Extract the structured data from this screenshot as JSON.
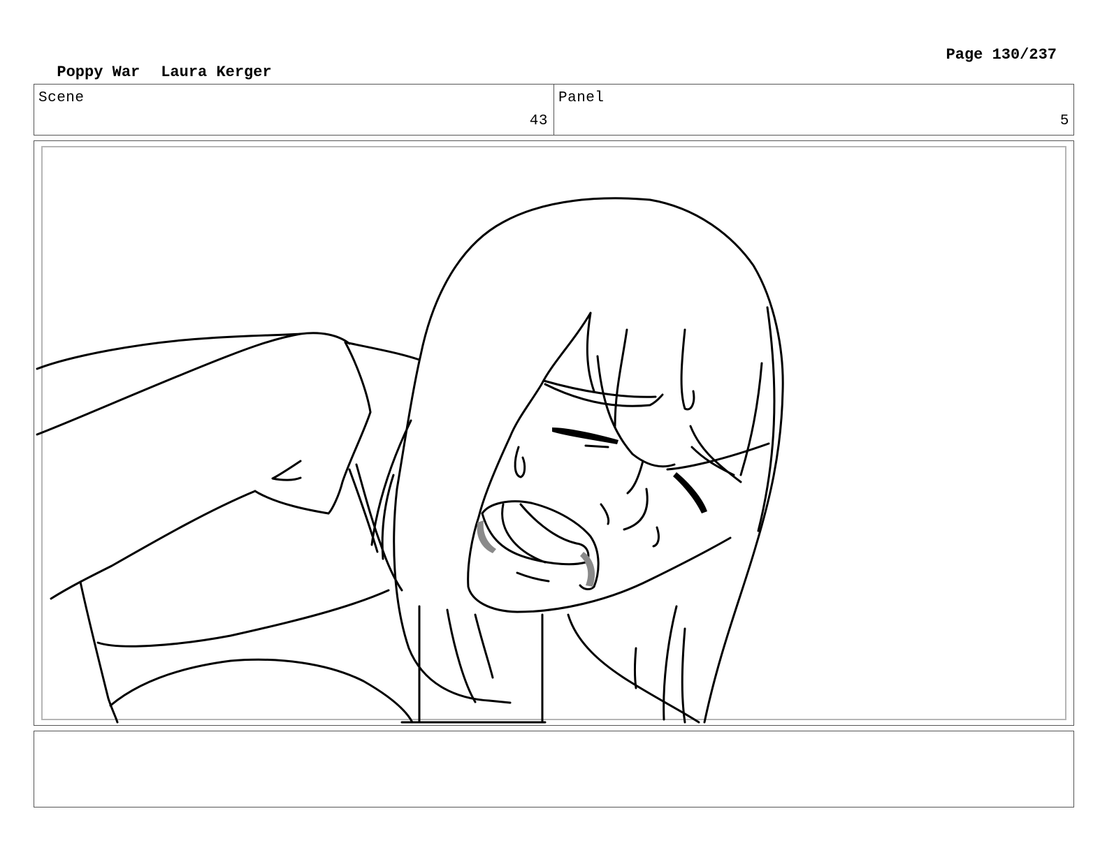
{
  "header": {
    "project": "Poppy War",
    "artist": "Laura Kerger",
    "page": "Page 130/237"
  },
  "info": {
    "scene_label": "Scene",
    "scene_value": "43",
    "panel_label": "Panel",
    "panel_value": "5"
  },
  "notes": {
    "text": ""
  },
  "colors": {
    "line": "#000000",
    "frame_border": "#555555",
    "inner_border": "#b5b5b5",
    "mouth_shade": "#8a8a8a"
  }
}
